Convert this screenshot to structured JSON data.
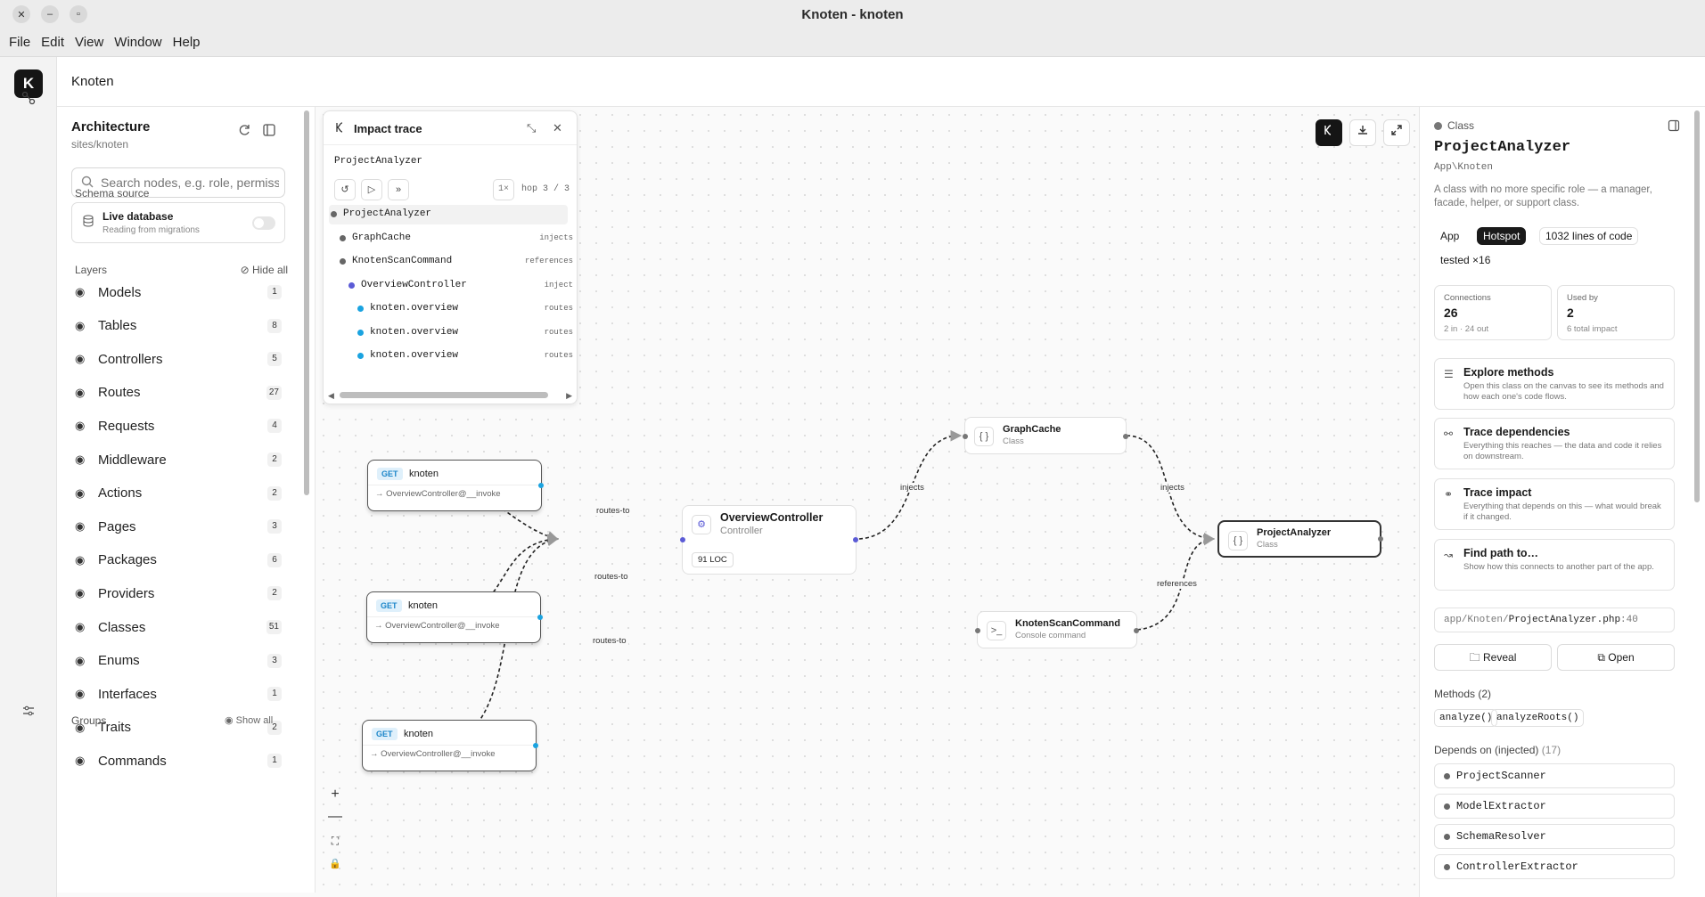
{
  "window": {
    "title": "Knoten - knoten",
    "btn_close": "✕",
    "btn_min": "–",
    "btn_max": "▫"
  },
  "menu": [
    "File",
    "Edit",
    "View",
    "Window",
    "Help"
  ],
  "app": {
    "name": "Knoten",
    "logo": "K"
  },
  "sidebar": {
    "title": "Architecture",
    "subtitle": "sites/knoten",
    "search_placeholder": "Search nodes, e.g. role, permissions",
    "schema_label": "Schema source",
    "schema_title": "Live database",
    "schema_sub": "Reading from migrations",
    "layers_label": "Layers",
    "hide_all": "Hide all",
    "layers": [
      {
        "name": "Models",
        "count": "1"
      },
      {
        "name": "Tables",
        "count": "8"
      },
      {
        "name": "Controllers",
        "count": "5"
      },
      {
        "name": "Routes",
        "count": "27"
      },
      {
        "name": "Requests",
        "count": "4"
      },
      {
        "name": "Middleware",
        "count": "2"
      },
      {
        "name": "Actions",
        "count": "2"
      },
      {
        "name": "Pages",
        "count": "3"
      },
      {
        "name": "Packages",
        "count": "6"
      },
      {
        "name": "Providers",
        "count": "2"
      },
      {
        "name": "Classes",
        "count": "51"
      },
      {
        "name": "Enums",
        "count": "3"
      },
      {
        "name": "Interfaces",
        "count": "1"
      },
      {
        "name": "Traits",
        "count": "2"
      },
      {
        "name": "Commands",
        "count": "1"
      }
    ],
    "groups_label": "Groups",
    "show_all": "Show all"
  },
  "impact": {
    "title": "Impact trace",
    "root": "ProjectAnalyzer",
    "speed": "1×",
    "hop": "hop 3 / 3",
    "rows": [
      {
        "label": "ProjectAnalyzer",
        "rel": "",
        "color": "#666666"
      },
      {
        "label": "GraphCache",
        "rel": "injects",
        "color": "#666666"
      },
      {
        "label": "KnotenScanCommand",
        "rel": "references",
        "color": "#666666"
      },
      {
        "label": "OverviewController",
        "rel": "inject",
        "color": "#5b5bd6"
      },
      {
        "label": "knoten.overview",
        "rel": "routes",
        "color": "#1aa3e0"
      },
      {
        "label": "knoten.overview",
        "rel": "routes",
        "color": "#1aa3e0"
      },
      {
        "label": "knoten.overview",
        "rel": "routes",
        "color": "#1aa3e0"
      }
    ]
  },
  "canvas": {
    "routes": [
      {
        "method": "GET",
        "name": "knoten",
        "handler": "→ OverviewController@__invoke"
      },
      {
        "method": "GET",
        "name": "knoten",
        "handler": "→ OverviewController@__invoke"
      },
      {
        "method": "GET",
        "name": "knoten",
        "handler": "→ OverviewController@__invoke"
      }
    ],
    "controller": {
      "title": "OverviewController",
      "sub": "Controller",
      "loc": "91 LOC"
    },
    "graphcache": {
      "title": "GraphCache",
      "sub": "Class"
    },
    "analyzer": {
      "title": "ProjectAnalyzer",
      "sub": "Class"
    },
    "command": {
      "title": "KnotenScanCommand",
      "sub": "Console command"
    },
    "edges": {
      "r1": "routes-to",
      "r2": "routes-to",
      "r3": "routes-to",
      "inj1": "injects",
      "inj2": "injects",
      "refs": "references"
    },
    "zoom": {
      "in": "+",
      "out": "—",
      "fit": "⛶",
      "lock": "🔒"
    }
  },
  "detail": {
    "kind": "Class",
    "title": "ProjectAnalyzer",
    "namespace": "App\\Knoten",
    "description": "A class with no more specific role — a manager, facade, helper, or support class.",
    "tags": [
      "App",
      "Hotspot",
      "1032 lines of code",
      "tested ×16"
    ],
    "connections": {
      "label": "Connections",
      "value": "26",
      "sub": "2 in · 24 out"
    },
    "usedby": {
      "label": "Used by",
      "value": "2",
      "sub": "6 total impact"
    },
    "actions": [
      {
        "title": "Explore methods",
        "desc": "Open this class on the canvas to see its methods and how each one's code flows."
      },
      {
        "title": "Trace dependencies",
        "desc": "Everything this reaches — the data and code it relies on downstream."
      },
      {
        "title": "Trace impact",
        "desc": "Everything that depends on this — what would break if it changed."
      },
      {
        "title": "Find path to…",
        "desc": "Show how this connects to another part of the app."
      }
    ],
    "path_prefix": "app/Knoten/",
    "path_file": "ProjectAnalyzer.php",
    "path_line": ":40",
    "reveal": "Reveal",
    "open": "Open",
    "methods_label": "Methods",
    "methods_count": "(2)",
    "methods": [
      "analyze()",
      "analyzeRoots()"
    ],
    "depends_label": "Depends on (injected)",
    "depends_count": "(17)",
    "depends": [
      "ProjectScanner",
      "ModelExtractor",
      "SchemaResolver",
      "ControllerExtractor"
    ]
  }
}
